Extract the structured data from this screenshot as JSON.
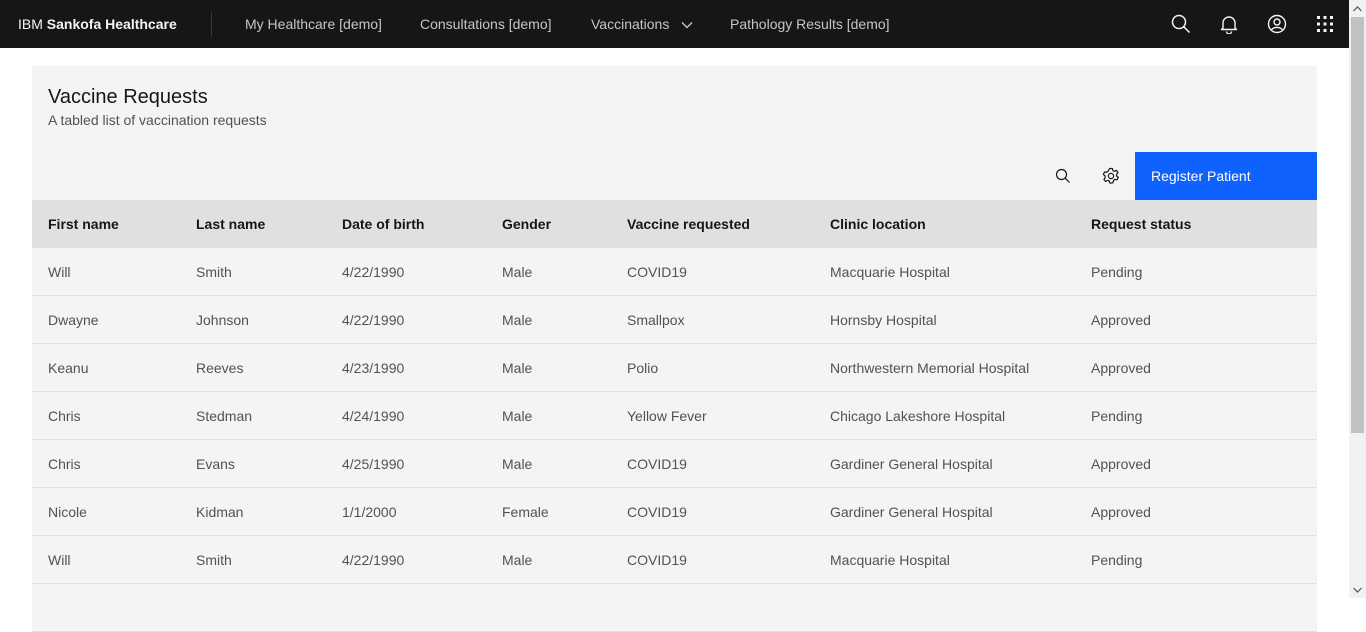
{
  "header": {
    "brand_prefix": "IBM",
    "brand_name": "Sankofa Healthcare",
    "nav": [
      {
        "label": "My Healthcare [demo]"
      },
      {
        "label": "Consultations [demo]"
      },
      {
        "label": "Vaccinations"
      },
      {
        "label": "Pathology Results [demo]"
      }
    ],
    "icons": [
      "search-icon",
      "notification-icon",
      "user-avatar-icon",
      "app-switcher-icon"
    ]
  },
  "page": {
    "title": "Vaccine Requests",
    "subtitle": "A tabled list of vaccination requests",
    "register_button": "Register Patient"
  },
  "table": {
    "columns": [
      "First name",
      "Last name",
      "Date of birth",
      "Gender",
      "Vaccine requested",
      "Clinic location",
      "Request status"
    ],
    "rows": [
      [
        "Will",
        "Smith",
        "4/22/1990",
        "Male",
        "COVID19",
        "Macquarie Hospital",
        "Pending"
      ],
      [
        "Dwayne",
        "Johnson",
        "4/22/1990",
        "Male",
        "Smallpox",
        "Hornsby Hospital",
        "Approved"
      ],
      [
        "Keanu",
        "Reeves",
        "4/23/1990",
        "Male",
        "Polio",
        "Northwestern Memorial Hospital",
        "Approved"
      ],
      [
        "Chris",
        "Stedman",
        "4/24/1990",
        "Male",
        "Yellow Fever",
        "Chicago Lakeshore Hospital",
        "Pending"
      ],
      [
        "Chris",
        "Evans",
        "4/25/1990",
        "Male",
        "COVID19",
        "Gardiner General Hospital",
        "Approved"
      ],
      [
        "Nicole",
        "Kidman",
        "1/1/2000",
        "Female",
        "COVID19",
        "Gardiner General Hospital",
        "Approved"
      ],
      [
        "Will",
        "Smith",
        "4/22/1990",
        "Male",
        "COVID19",
        "Macquarie Hospital",
        "Pending"
      ],
      [
        "",
        "",
        "",
        "",
        "",
        "",
        ""
      ]
    ]
  },
  "colors": {
    "header_bg": "#161616",
    "primary": "#0f62fe",
    "card_bg": "#f4f4f4",
    "table_header_bg": "#e0e0e0"
  }
}
